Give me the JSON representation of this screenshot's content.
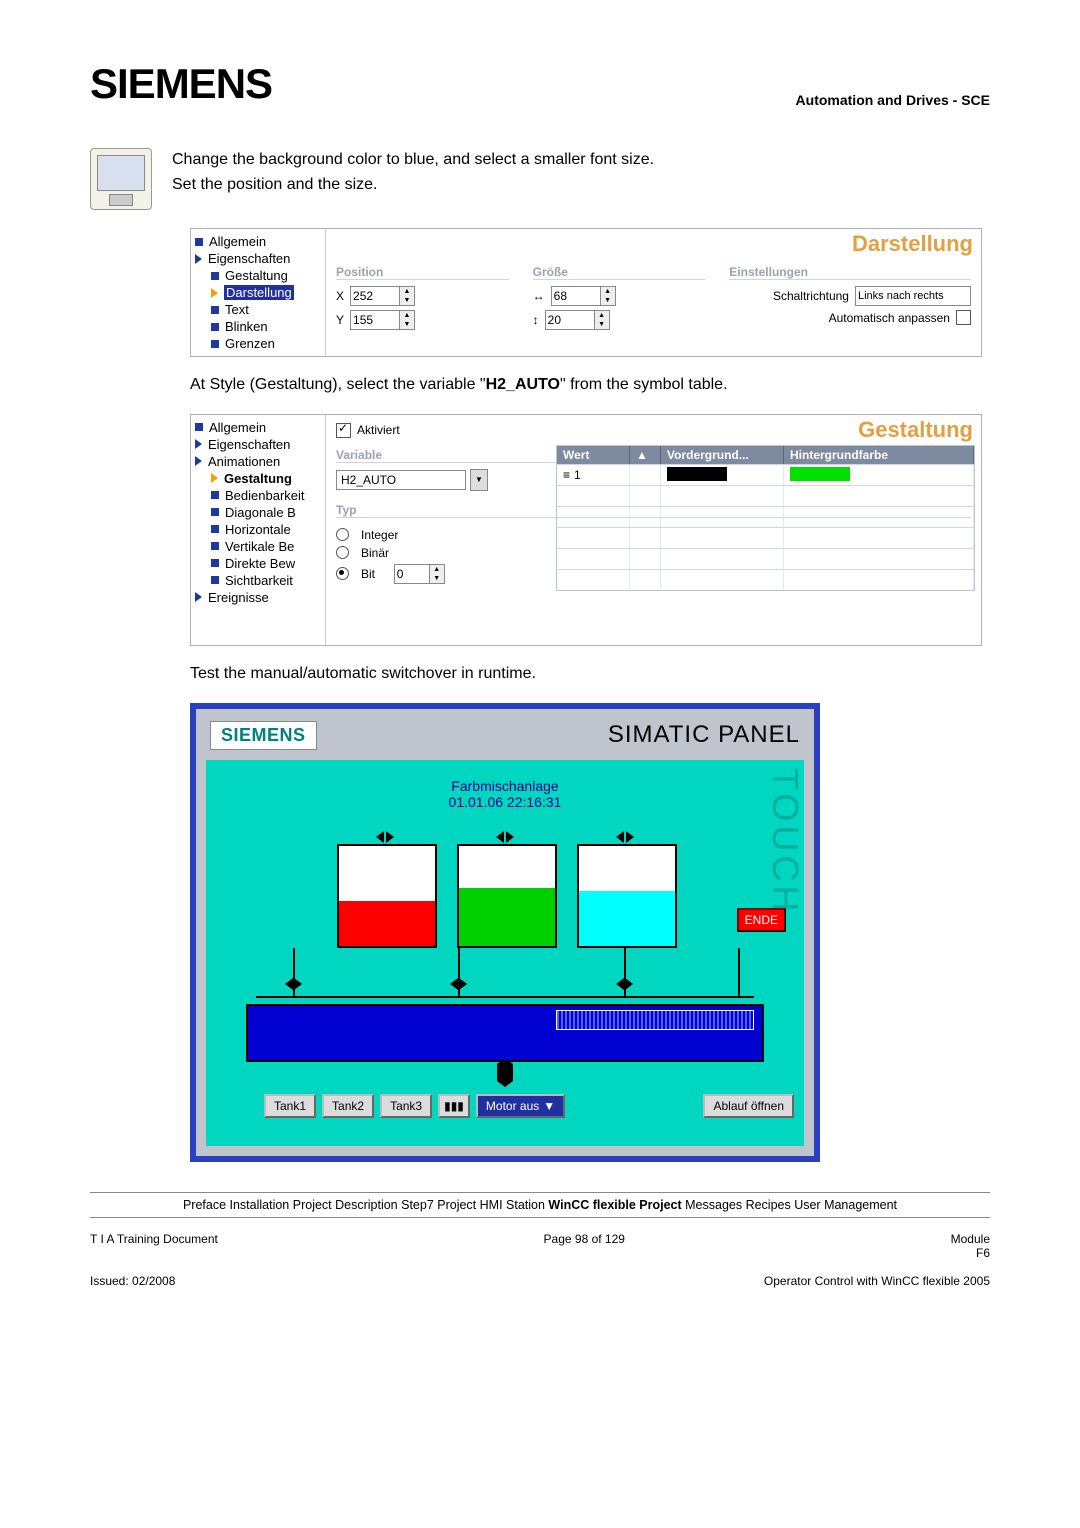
{
  "header": {
    "logo": "SIEMENS",
    "right": "Automation and Drives - SCE"
  },
  "para1a": "Change the background color to blue, and select a smaller font size.",
  "para1b": "Set the position and the size.",
  "panel1": {
    "title": "Darstellung",
    "tree": {
      "t1": "Allgemein",
      "t2": "Eigenschaften",
      "t3": "Gestaltung",
      "t4": "Darstellung",
      "t5": "Text",
      "t6": "Blinken",
      "t7": "Grenzen"
    },
    "grp_pos": "Position",
    "grp_size": "Größe",
    "grp_set": "Einstellungen",
    "x_lbl": "X",
    "x_val": "252",
    "y_lbl": "Y",
    "y_val": "155",
    "w_val": "68",
    "h_val": "20",
    "schalt_lbl": "Schaltrichtung",
    "schalt_val": "Links nach rechts",
    "auto_lbl": "Automatisch anpassen"
  },
  "para2a": "At Style (Gestaltung), select the variable  \"",
  "para2b": "H2_AUTO",
  "para2c": "\" from the symbol table.",
  "panel2": {
    "title": "Gestaltung",
    "tree": {
      "t1": "Allgemein",
      "t2": "Eigenschaften",
      "t3": "Animationen",
      "t4": "Gestaltung",
      "t5": "Bedienbarkeit",
      "t6": "Diagonale B",
      "t7": "Horizontale",
      "t8": "Vertikale Be",
      "t9": "Direkte Bew",
      "t10": "Sichtbarkeit",
      "t11": "Ereignisse"
    },
    "aktiviert": "Aktiviert",
    "var_hdr": "Variable",
    "var_val": "H2_AUTO",
    "typ_hdr": "Typ",
    "r1": "Integer",
    "r2": "Binär",
    "r3": "Bit",
    "bit_val": "0",
    "wert_hdr": "Wert",
    "vg_hdr": "Vordergrund...",
    "hg_hdr": "Hintergrundfarbe",
    "wert_1": "1"
  },
  "para3": "Test the manual/automatic switchover in runtime.",
  "simatic": {
    "brand": "SIEMENS",
    "title": "SIMATIC PANEL",
    "touch": "TOUCH",
    "line1": "Farbmischanlage",
    "line2": "01.01.06 22:16:31",
    "ende": "ENDE",
    "b1": "Tank1",
    "b2": "Tank2",
    "b3": "Tank3",
    "bmotor": "Motor aus",
    "bablauf": "Ablauf öffnen"
  },
  "bottombar": {
    "items": "Preface  Installation  Project Description  Step7 Project  HMI Station  ",
    "bold": "WinCC flexible Project",
    "rest": "  Messages  Recipes  User Management"
  },
  "footer": {
    "l1": "T I A  Training Document",
    "c1": "Page 98 of 129",
    "r1": "Module",
    "r2": "F6",
    "l2": "Issued: 02/2008",
    "r3": "Operator Control with WinCC flexible 2005"
  }
}
